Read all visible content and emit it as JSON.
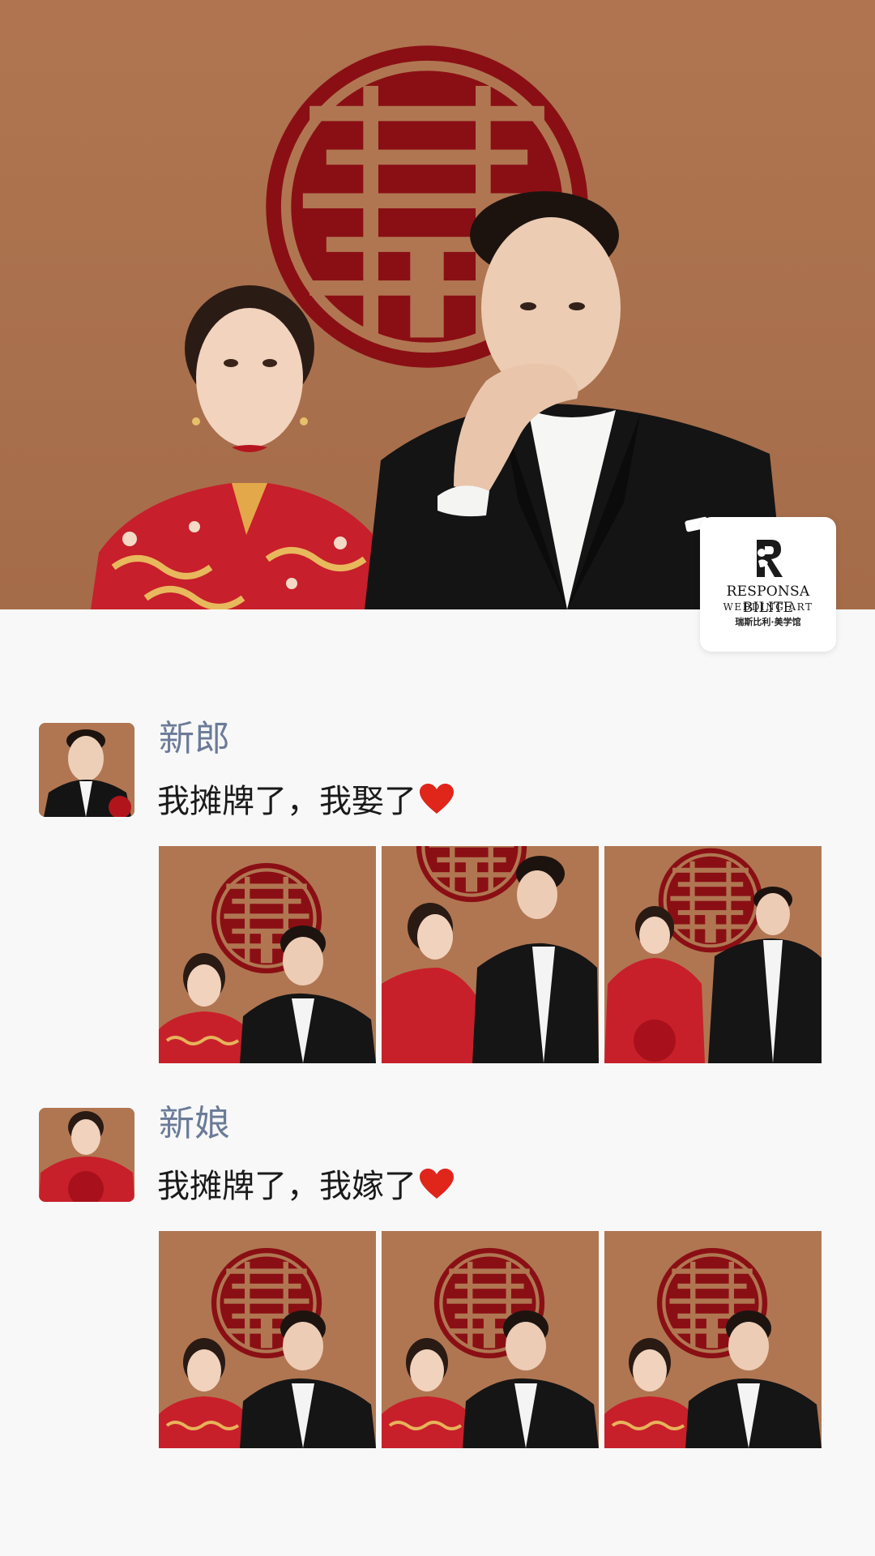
{
  "colors": {
    "background": "#f8f8f8",
    "author_name": "#6b7b98",
    "message_text": "#1a1a1a",
    "heart": "#e0251b",
    "photo_backdrop": "#b07652",
    "double_happiness_red": "#8a0f14"
  },
  "logo": {
    "name": "RESPONSA BILITE",
    "subtitle": "WEDDING ART",
    "chinese": "瑞斯比利·美学馆"
  },
  "posts": [
    {
      "author": "新郎",
      "message": "我摊牌了，我娶了",
      "icon": "heart-icon",
      "photo_count": 3
    },
    {
      "author": "新娘",
      "message": "我摊牌了，我嫁了",
      "icon": "heart-icon",
      "photo_count": 3
    }
  ]
}
